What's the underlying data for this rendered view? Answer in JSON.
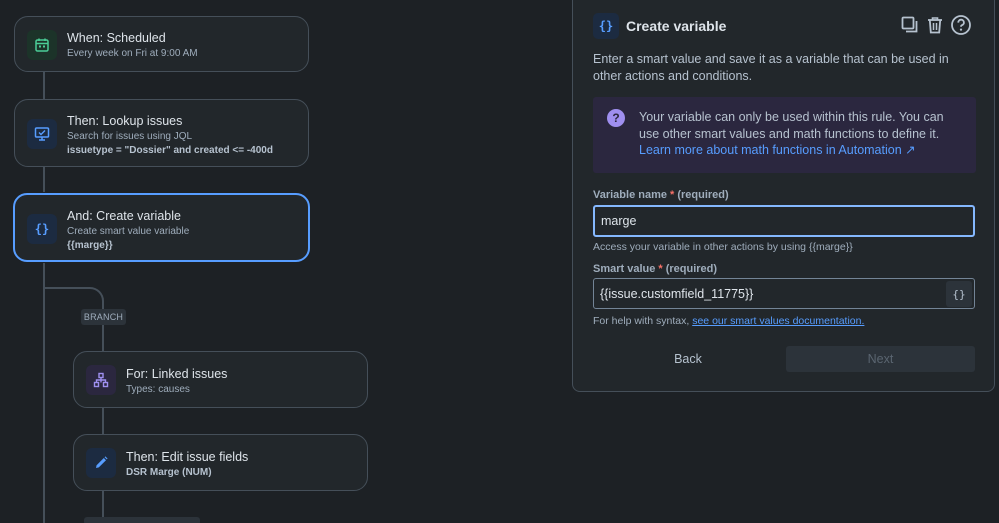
{
  "flow": {
    "cards": [
      {
        "title": "When: Scheduled",
        "sub": "Every week on Fri at 9:00 AM",
        "sub2": ""
      },
      {
        "title": "Then: Lookup issues",
        "sub": "Search for issues using JQL",
        "sub2": "issuetype = \"Dossier\" and created <= -400d"
      },
      {
        "title": "And: Create variable",
        "sub": "Create smart value variable",
        "sub2": "{{marge}}",
        "icon_text": "{}"
      },
      {
        "title": "For: Linked issues",
        "sub": "Types: causes",
        "sub2": ""
      },
      {
        "title": "Then: Edit issue fields",
        "sub": "DSR Marge (NUM)",
        "sub2": ""
      }
    ],
    "branch_label": "BRANCH"
  },
  "panel": {
    "icon_text": "{}",
    "title": "Create variable",
    "description": "Enter a smart value and save it as a variable that can be used in other actions and conditions.",
    "info": {
      "text": "Your variable can only be used within this rule. You can use other smart values and math functions to define it. ",
      "link": "Learn more about math functions in Automation ↗",
      "icon_text": "?"
    },
    "variable_name": {
      "label": "Variable name",
      "asterisk": "*",
      "required": "(required)",
      "value": "marge",
      "help": "Access your variable in other actions by using {{marge}}"
    },
    "smart_value": {
      "label": "Smart value",
      "asterisk": "*",
      "required": "(required)",
      "value": "{{issue.customfield_11775}}",
      "brace_button": "{}",
      "help": "For help with syntax, ",
      "help_link": "see our smart values documentation."
    },
    "back_label": "Back",
    "next_label": "Next"
  },
  "colors": {
    "background": "#1d2125",
    "accent_blue": "#579dff",
    "discovery_purple": "#9f8fef",
    "success_green": "#4bce97"
  },
  "icons": [
    "calendar-icon",
    "monitor-search-icon",
    "braces-icon",
    "hierarchy-icon",
    "pencil-icon",
    "duplicate-icon",
    "trash-icon",
    "help-icon",
    "question-icon"
  ]
}
